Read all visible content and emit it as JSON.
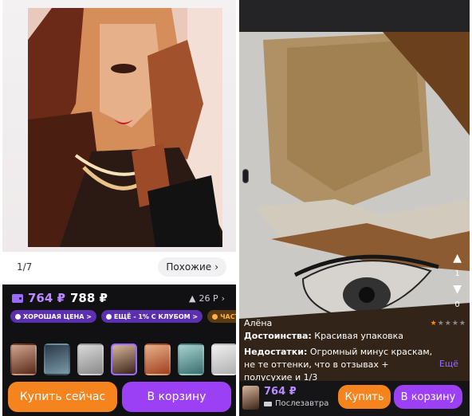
{
  "left": {
    "gallery_counter": "1/7",
    "similar_label": "Похожие",
    "price_main": "764 ₽",
    "price_old": "788 ₽",
    "rating": "26 Р",
    "chips": [
      "ХОРОШАЯ ЦЕНА >",
      "ЕЩЁ - 1% С КЛУБОМ >",
      "ЧАСТЯМИ"
    ],
    "buy_now": "Купить сейчас",
    "to_cart": "В корзину"
  },
  "right": {
    "author": "Алёна",
    "rating_stars": 1,
    "likes": "1",
    "dislikes": "0",
    "pros_label": "Достоинства:",
    "pros_text": "Красивая упаковка",
    "cons_label": "Недостатки:",
    "cons_text": "Огромный минус краскам, не те оттенки, что в отзывах + полусухие и 1/3",
    "more": "Ещё",
    "price": "764 ₽",
    "delivery": "Послезавтра",
    "buy": "Купить",
    "cart": "В корзину"
  },
  "colors": {
    "accent_purple": "#9b40f5",
    "accent_orange": "#f5841f",
    "price_purple": "#b98cff"
  }
}
